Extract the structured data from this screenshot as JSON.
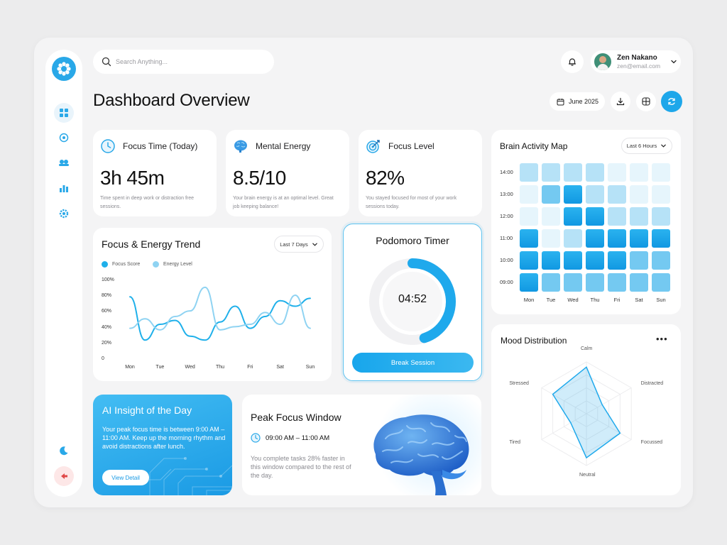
{
  "search": {
    "placeholder": "Search Anything..."
  },
  "user": {
    "name": "Zen Nakano",
    "email": "zen@email.com"
  },
  "page": {
    "title": "Dashboard Overview",
    "date": "June 2025"
  },
  "stats": [
    {
      "label": "Focus Time (Today)",
      "value": "3h 45m",
      "desc": "Time spent in deep work or distraction free sessions.",
      "icon": "clock-icon"
    },
    {
      "label": "Mental Energy",
      "value": "8.5/10",
      "desc": "Your brain energy is at an optimal level. Great job keeping balance!",
      "icon": "brain-icon"
    },
    {
      "label": "Focus Level",
      "value": "82%",
      "desc": "You stayed focused for most of your work sessions today.",
      "icon": "target-icon"
    }
  ],
  "trend": {
    "title": "Focus & Energy Trend",
    "range": "Last 7 Days",
    "legend": [
      "Focus Score",
      "Energy Level"
    ]
  },
  "chart_data": {
    "type": "line",
    "title": "Focus & Energy Trend",
    "x": [
      "Mon",
      "Tue",
      "Wed",
      "Thu",
      "Fri",
      "Sat",
      "Sun"
    ],
    "y_ticks": [
      "100%",
      "80%",
      "60%",
      "40%",
      "20%",
      "0"
    ],
    "ylim": [
      0,
      100
    ],
    "series": [
      {
        "name": "Focus Score",
        "color": "#1fb0ea",
        "values": [
          80,
          25,
          45,
          50,
          30,
          25,
          48,
          68,
          40,
          55,
          75,
          68,
          78
        ]
      },
      {
        "name": "Energy Level",
        "color": "#8fd3f2",
        "values": [
          40,
          52,
          38,
          55,
          62,
          92,
          38,
          42,
          45,
          60,
          45,
          82,
          40
        ]
      }
    ]
  },
  "timer": {
    "title": "Podomoro Timer",
    "time": "04:52",
    "progress": 0.45,
    "button": "Break Session"
  },
  "heatmap": {
    "title": "Brain Activity Map",
    "range": "Last 6 Hours",
    "rows": [
      "14:00",
      "13:00",
      "12:00",
      "11:00",
      "10:00",
      "09:00"
    ],
    "cols": [
      "Mon",
      "Tue",
      "Wed",
      "Thu",
      "Fri",
      "Sat",
      "Sun"
    ],
    "levels": [
      [
        2,
        2,
        2,
        2,
        1,
        1,
        1
      ],
      [
        1,
        3,
        4,
        2,
        2,
        1,
        1
      ],
      [
        1,
        1,
        4,
        4,
        2,
        2,
        2
      ],
      [
        4,
        1,
        2,
        4,
        4,
        4,
        4
      ],
      [
        4,
        4,
        4,
        4,
        4,
        3,
        3
      ],
      [
        4,
        3,
        3,
        3,
        3,
        3,
        3
      ]
    ]
  },
  "mood": {
    "title": "Mood Distribution",
    "axes": [
      "Calm",
      "Distracted",
      "Focussed",
      "Neutral",
      "Tired",
      "Stressed"
    ],
    "values": [
      0.9,
      0.35,
      0.75,
      0.85,
      0.35,
      0.75
    ]
  },
  "insight": {
    "title": "AI Insight of the Day",
    "text": "Your peak focus time is between 9:00 AM – 11:00 AM. Keep up the morning rhythm and avoid distractions after lunch.",
    "button": "View Detail"
  },
  "peak": {
    "title": "Peak Focus Window",
    "time": "09:00 AM – 11:00 AM",
    "text": "You complete tasks 28% faster in this window compared to the rest of the day."
  }
}
